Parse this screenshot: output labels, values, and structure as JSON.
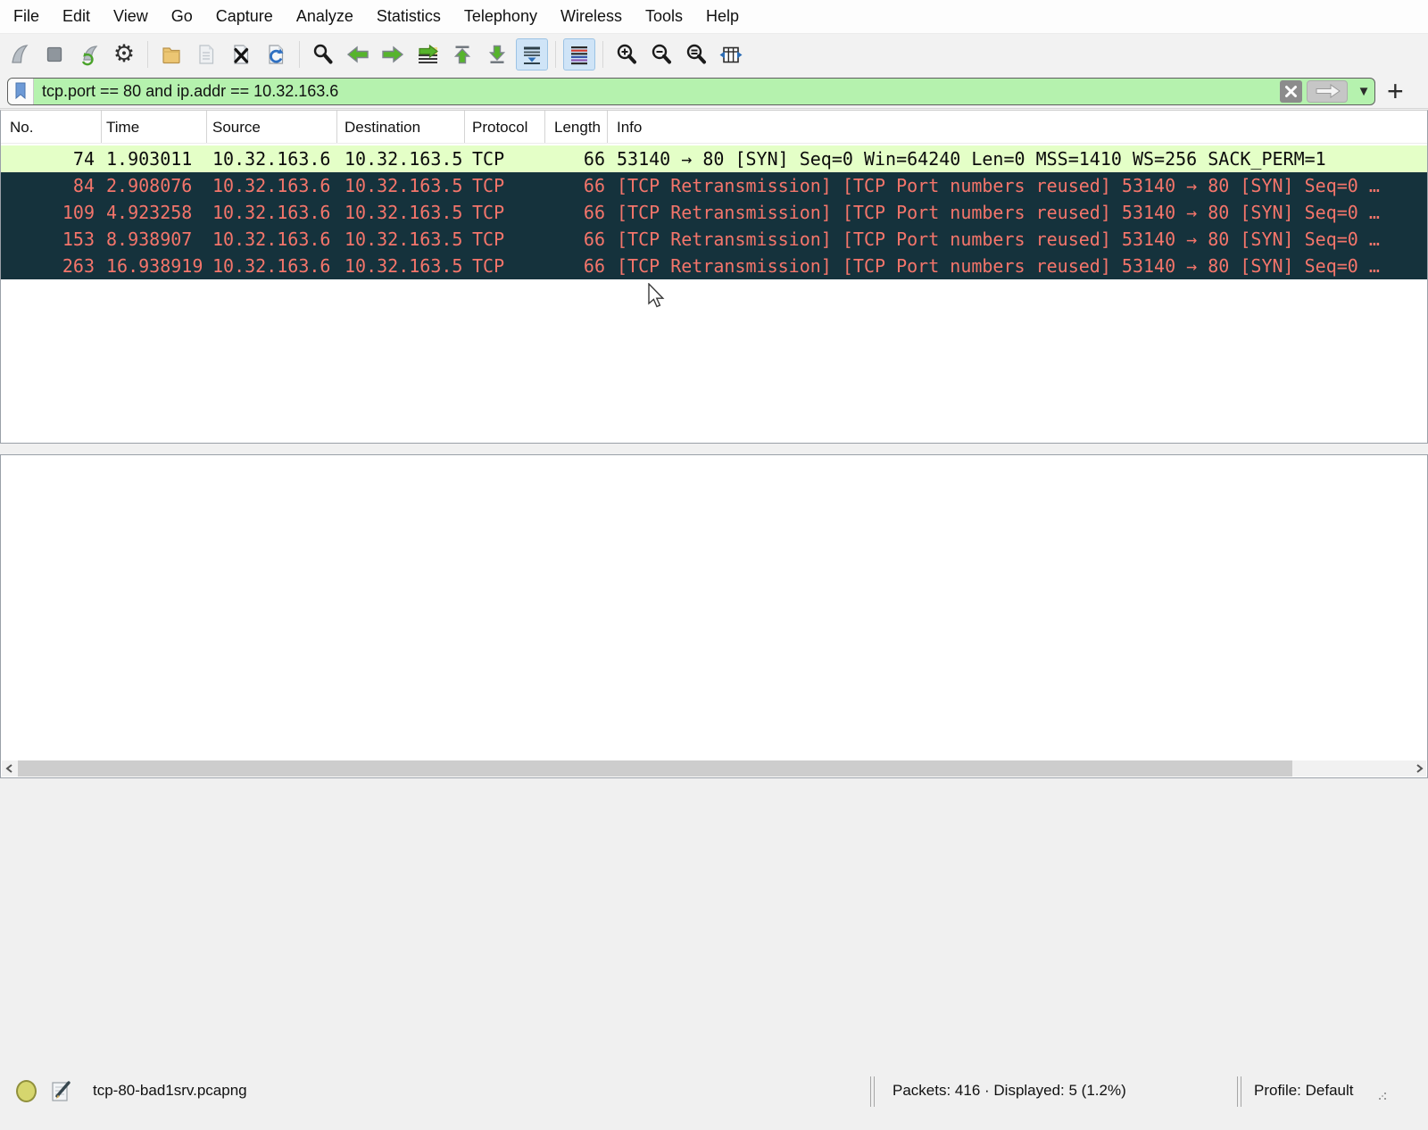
{
  "menu": {
    "items": [
      "File",
      "Edit",
      "View",
      "Go",
      "Capture",
      "Analyze",
      "Statistics",
      "Telephony",
      "Wireless",
      "Tools",
      "Help"
    ]
  },
  "toolbar": {
    "icons": [
      {
        "name": "shark-fin-start-icon",
        "state": "disabled"
      },
      {
        "name": "stop-capture-icon",
        "state": "disabled"
      },
      {
        "name": "restart-capture-icon",
        "state": "disabled"
      },
      {
        "name": "capture-options-gear-icon",
        "state": "disabled"
      },
      {
        "name": "open-folder-icon",
        "state": "enabled"
      },
      {
        "name": "save-file-icon",
        "state": "disabled"
      },
      {
        "name": "close-file-icon",
        "state": "enabled"
      },
      {
        "name": "reload-file-icon",
        "state": "enabled"
      },
      {
        "name": "find-packet-icon",
        "state": "enabled"
      },
      {
        "name": "go-back-arrow-icon",
        "state": "enabled"
      },
      {
        "name": "go-forward-arrow-icon",
        "state": "enabled"
      },
      {
        "name": "go-to-packet-icon",
        "state": "enabled"
      },
      {
        "name": "go-first-packet-icon",
        "state": "enabled"
      },
      {
        "name": "go-last-packet-icon",
        "state": "enabled"
      },
      {
        "name": "auto-scroll-icon",
        "state": "active"
      },
      {
        "name": "colorize-packets-icon",
        "state": "active"
      },
      {
        "name": "zoom-in-icon",
        "state": "enabled"
      },
      {
        "name": "zoom-out-icon",
        "state": "enabled"
      },
      {
        "name": "zoom-reset-icon",
        "state": "enabled"
      },
      {
        "name": "resize-columns-icon",
        "state": "enabled"
      }
    ],
    "gear_glyph": "⚙"
  },
  "filter": {
    "value": "tcp.port == 80 and ip.addr == 10.32.163.6",
    "status": "valid",
    "add_button_label": "+",
    "dropdown_glyph": "▼"
  },
  "table": {
    "headers": [
      "No.",
      "Time",
      "Source",
      "Destination",
      "Protocol",
      "Length",
      "Info"
    ],
    "rows": [
      {
        "style": "good",
        "cells": [
          "74",
          "1.903011",
          "10.32.163.6",
          "10.32.163.5",
          "TCP",
          "66",
          "53140 → 80 [SYN] Seq=0 Win=64240 Len=0 MSS=1410 WS=256 SACK_PERM=1"
        ]
      },
      {
        "style": "bad",
        "cells": [
          "84",
          "2.908076",
          "10.32.163.6",
          "10.32.163.5",
          "TCP",
          "66",
          "[TCP Retransmission] [TCP Port numbers reused] 53140 → 80 [SYN] Seq=0 …"
        ]
      },
      {
        "style": "bad",
        "cells": [
          "109",
          "4.923258",
          "10.32.163.6",
          "10.32.163.5",
          "TCP",
          "66",
          "[TCP Retransmission] [TCP Port numbers reused] 53140 → 80 [SYN] Seq=0 …"
        ]
      },
      {
        "style": "bad",
        "cells": [
          "153",
          "8.938907",
          "10.32.163.6",
          "10.32.163.5",
          "TCP",
          "66",
          "[TCP Retransmission] [TCP Port numbers reused] 53140 → 80 [SYN] Seq=0 …"
        ]
      },
      {
        "style": "bad",
        "cells": [
          "263",
          "16.938919",
          "10.32.163.6",
          "10.32.163.5",
          "TCP",
          "66",
          "[TCP Retransmission] [TCP Port numbers reused] 53140 → 80 [SYN] Seq=0 …"
        ]
      }
    ]
  },
  "statusbar": {
    "filename": "tcp-80-bad1srv.pcapng",
    "packets_summary": "Packets: 416 · Displayed: 5 (1.2%)",
    "profile": "Profile: Default"
  },
  "colors": {
    "filter_valid_bg": "#b5f2ae",
    "row_good_bg": "#e4ffc7",
    "row_good_fg": "#0c0c0c",
    "row_bad_bg": "#15323c",
    "row_bad_fg": "#f4756b",
    "toolbar_active_bg": "#cfe4f7",
    "toolbar_active_border": "#9cc3e4",
    "nav_arrow_green": "#56b42c"
  }
}
